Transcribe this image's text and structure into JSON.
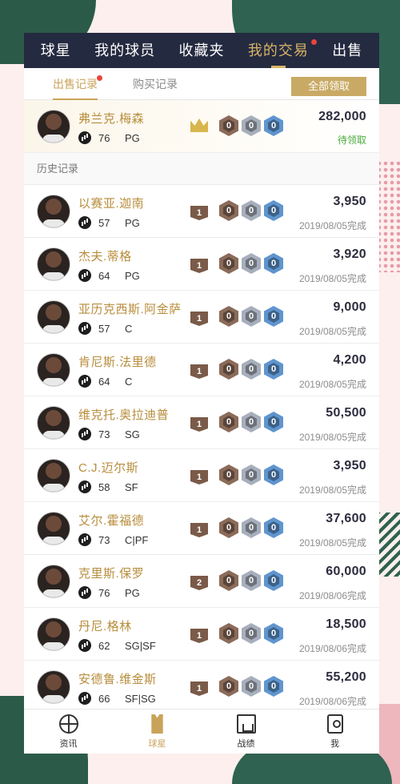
{
  "top_tabs": [
    {
      "label": "球星",
      "active": false,
      "dot": false
    },
    {
      "label": "我的球员",
      "active": false,
      "dot": false
    },
    {
      "label": "收藏夹",
      "active": false,
      "dot": false
    },
    {
      "label": "我的交易",
      "active": true,
      "dot": true
    },
    {
      "label": "出售",
      "active": false,
      "dot": false
    }
  ],
  "sub_tabs": {
    "sale_records": "出售记录",
    "purchase_records": "购买记录",
    "collect_all": "全部领取"
  },
  "current_sale": {
    "name": "弗兰克.梅森",
    "rating": "76",
    "position": "PG",
    "hex": [
      "0",
      "0",
      "0"
    ],
    "price": "282,000",
    "status": "待领取"
  },
  "history_label": "历史记录",
  "history": [
    {
      "name": "以赛亚.迦南",
      "rating": "57",
      "position": "PG",
      "tier": "1",
      "hex": [
        "0",
        "0",
        "0"
      ],
      "price": "3,950",
      "date": "2019/08/05完成"
    },
    {
      "name": "杰夫.蒂格",
      "rating": "64",
      "position": "PG",
      "tier": "1",
      "hex": [
        "0",
        "0",
        "0"
      ],
      "price": "3,920",
      "date": "2019/08/05完成"
    },
    {
      "name": "亚历克西斯.阿金萨",
      "rating": "57",
      "position": "C",
      "tier": "1",
      "hex": [
        "0",
        "0",
        "0"
      ],
      "price": "9,000",
      "date": "2019/08/05完成"
    },
    {
      "name": "肯尼斯.法里德",
      "rating": "64",
      "position": "C",
      "tier": "1",
      "hex": [
        "0",
        "0",
        "0"
      ],
      "price": "4,200",
      "date": "2019/08/05完成"
    },
    {
      "name": "维克托.奥拉迪普",
      "rating": "73",
      "position": "SG",
      "tier": "1",
      "hex": [
        "0",
        "0",
        "0"
      ],
      "price": "50,500",
      "date": "2019/08/05完成"
    },
    {
      "name": "C.J.迈尔斯",
      "rating": "58",
      "position": "SF",
      "tier": "1",
      "hex": [
        "0",
        "0",
        "0"
      ],
      "price": "3,950",
      "date": "2019/08/05完成"
    },
    {
      "name": "艾尔.霍福德",
      "rating": "73",
      "position": "C|PF",
      "tier": "1",
      "hex": [
        "0",
        "0",
        "0"
      ],
      "price": "37,600",
      "date": "2019/08/05完成"
    },
    {
      "name": "克里斯.保罗",
      "rating": "76",
      "position": "PG",
      "tier": "2",
      "hex": [
        "0",
        "0",
        "0"
      ],
      "price": "60,000",
      "date": "2019/08/06完成"
    },
    {
      "name": "丹尼.格林",
      "rating": "62",
      "position": "SG|SF",
      "tier": "1",
      "hex": [
        "0",
        "0",
        "0"
      ],
      "price": "18,500",
      "date": "2019/08/06完成"
    },
    {
      "name": "安德鲁.维金斯",
      "rating": "66",
      "position": "SF|SG",
      "tier": "1",
      "hex": [
        "0",
        "0",
        "0"
      ],
      "price": "55,200",
      "date": "2019/08/06完成"
    }
  ],
  "bottom_nav": [
    {
      "label": "资讯",
      "icon": "basketball-icon",
      "active": false
    },
    {
      "label": "球星",
      "icon": "jersey-icon",
      "active": true
    },
    {
      "label": "战绩",
      "icon": "hoop-icon",
      "active": false
    },
    {
      "label": "我",
      "icon": "profile-card-icon",
      "active": false
    }
  ],
  "colors": {
    "nav_bg": "#242a40",
    "gold": "#c9a35a",
    "collect_status": "#4aaa3e",
    "dot": "#e8453c"
  }
}
